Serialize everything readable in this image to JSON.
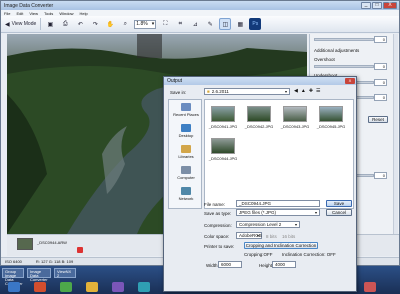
{
  "app": {
    "title": "Image Data Converter",
    "window_controls": [
      "_",
      "□",
      "X"
    ],
    "menu": [
      "File",
      "Edit",
      "View",
      "Tools",
      "Window",
      "Help"
    ],
    "toolbar": {
      "view_mode": "View Mode",
      "zoom": "1.8%"
    }
  },
  "right_panel": {
    "additional_adjustments": "Additional adjustments",
    "overshoot": "Overshoot",
    "undershoot": "Undershoot",
    "reset": "Reset",
    "values": [
      "0",
      "0",
      "0",
      "0",
      "0"
    ]
  },
  "filmstrip": {
    "filename": "_DSC0944.ARW"
  },
  "status": {
    "left": "ISO 6400",
    "right": "R: 127  G: 118  B: 109"
  },
  "taskbar": {
    "tasks": [
      "Group Image Data Converter",
      "Image Data Converter",
      "ViewNX 2"
    ]
  },
  "dialog": {
    "title": "Output",
    "save_in_label": "Save in:",
    "save_in_value": "2.6.2011",
    "places": [
      "Recent Places",
      "Desktop",
      "Libraries",
      "Computer",
      "Network"
    ],
    "files": [
      "_DSC0941.JPG",
      "_DSC0942.JPG",
      "_DSC0943.JPG",
      "_DSC0945.JPG",
      "_DSC0944.JPG"
    ],
    "file_name_label": "File name:",
    "file_name_value": "_DSC0944.JPG",
    "save_type_label": "Save as type:",
    "save_type_value": "JPEG files (*.JPG)",
    "save_button": "Save",
    "cancel_button": "Cancel",
    "compression_label": "Compression:",
    "compression_value": "Compression Level 2",
    "color_space_label": "Color space:",
    "color_space_value": "AdobeRGB",
    "bits_8": "8 bits",
    "bits_16": "16 bits",
    "printer_label": "Printer to save:",
    "cropping_button": "Cropping and Inclination Correction",
    "cropping_status": "Cropping:OFF",
    "inclination_status": "Inclination Correction: OFF",
    "width_label": "Width:",
    "width_value": "6000",
    "height_label": "Height:",
    "height_value": "4000"
  }
}
